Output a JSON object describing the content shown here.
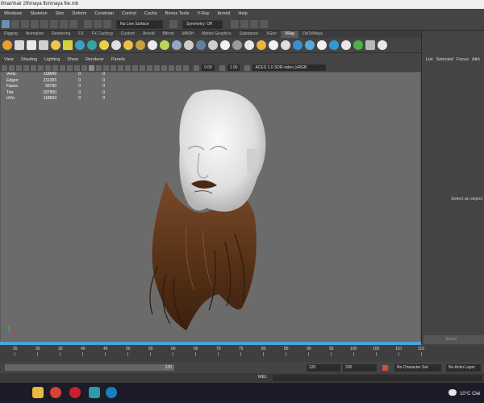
{
  "window": {
    "title": "ll\\hair\\hair 29\\maya fbx\\maya file.mb"
  },
  "menubar": [
    "Windows",
    "Skeleton",
    "Skin",
    "Deform",
    "Constrain",
    "Control",
    "Cache",
    "Bonus Tools",
    "V-Ray",
    "Arnold",
    "Help"
  ],
  "statusline": {
    "live_surface": "No Live Surface",
    "symmetry": "Symmetry: Off"
  },
  "shelf": {
    "tabs": [
      "Rigging",
      "Animation",
      "Rendering",
      "FX",
      "FX Caching",
      "Custom",
      "Arnold",
      "Bifrost",
      "MASH",
      "Motion Graphics",
      "Substance",
      "XGen",
      "VRay",
      "DisToMaya"
    ],
    "active_tab": "VRay"
  },
  "panel_menu": [
    "View",
    "Shading",
    "Lighting",
    "Show",
    "Renderer",
    "Panels"
  ],
  "view_toolbar": {
    "exposure": "0.00",
    "gamma": "1.00",
    "colorspace": "ACES 1.0 SDR-video (sRGB"
  },
  "hud": [
    {
      "label": "Verts:",
      "v1": "118049",
      "v2": "0",
      "v3": "0"
    },
    {
      "label": "Edges:",
      "v1": "211393",
      "v2": "0",
      "v3": "0"
    },
    {
      "label": "Faces:",
      "v1": "93790",
      "v2": "0",
      "v3": "0"
    },
    {
      "label": "Tris:",
      "v1": "187550",
      "v2": "0",
      "v3": "0"
    },
    {
      "label": "UVs:",
      "v1": "118663",
      "v2": "0",
      "v3": "0"
    }
  ],
  "right_panel": {
    "menu": [
      "List",
      "Selected",
      "Focus",
      "Attri"
    ],
    "message": "Select an object",
    "select_btn": "Select"
  },
  "timeline": {
    "ticks": [
      "25",
      "30",
      "35",
      "40",
      "45",
      "50",
      "55",
      "60",
      "65",
      "70",
      "75",
      "80",
      "85",
      "90",
      "95",
      "100",
      "105",
      "110",
      "115"
    ]
  },
  "range": {
    "start_field": "120",
    "end_field": "120",
    "max_field": "200",
    "character_set": "No Character Set",
    "anim_layer": "No Anim Layer"
  },
  "cmdline": {
    "label": "MEL"
  },
  "taskbar": {
    "weather": "10°C Clel"
  }
}
